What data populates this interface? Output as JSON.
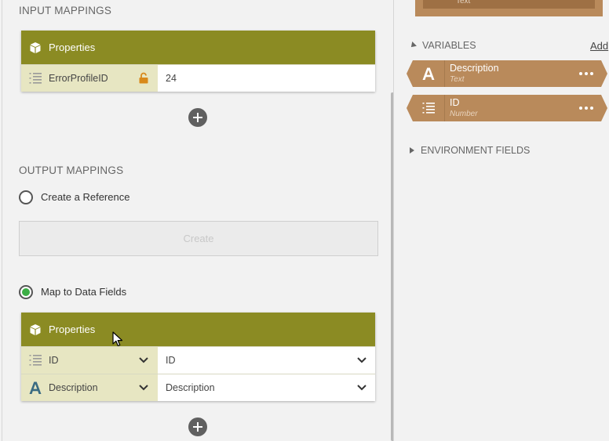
{
  "input_mappings": {
    "title": "INPUT MAPPINGS",
    "properties_header": "Properties",
    "rows": [
      {
        "name": "ErrorProfileID",
        "value": "24",
        "type_icon": "number-list-icon",
        "locked": true
      }
    ]
  },
  "output_mappings": {
    "title": "OUTPUT MAPPINGS",
    "create_reference_label": "Create a Reference",
    "create_button_label": "Create",
    "map_to_fields_label": "Map to Data Fields",
    "selected_option": "Map to Data Fields",
    "properties_header": "Properties",
    "rows": [
      {
        "name": "ID",
        "value": "ID",
        "type_icon": "number-list-icon"
      },
      {
        "name": "Description",
        "value": "Description",
        "type_icon": "text-a-icon"
      }
    ]
  },
  "right_panel": {
    "top_chip_type": "Text",
    "variables_title": "VARIABLES",
    "add_label": "Add",
    "variables": [
      {
        "name": "Description",
        "type": "Text",
        "icon": "text-a-icon"
      },
      {
        "name": "ID",
        "type": "Number",
        "icon": "number-list-icon"
      }
    ],
    "environment_title": "ENVIRONMENT FIELDS"
  },
  "colors": {
    "properties_header": "#8b8b23",
    "property_name_bg": "#e7e6c2",
    "variable_chip": "#b98a5b",
    "radio_selected": "#3cae45"
  }
}
